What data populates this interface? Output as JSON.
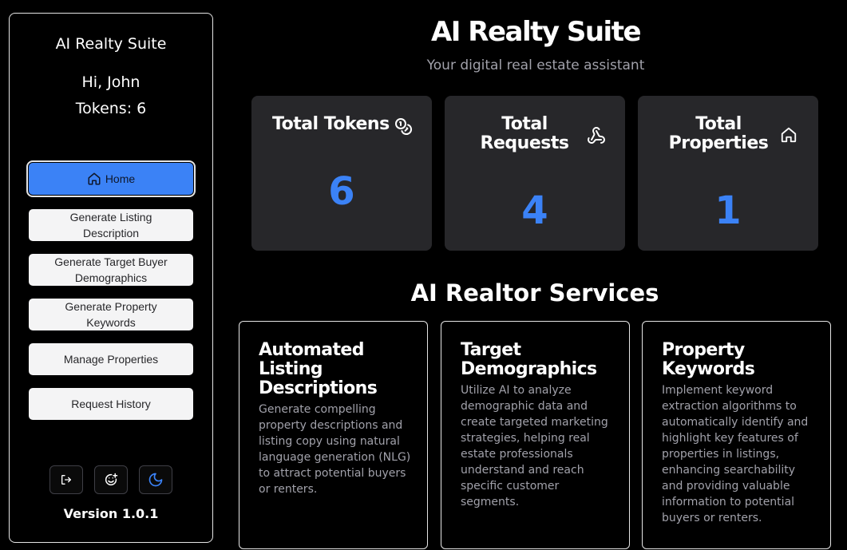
{
  "sidebar": {
    "title": "AI Realty Suite",
    "greeting": "Hi, John",
    "tokens": "Tokens: 6",
    "nav": [
      {
        "label": "Home"
      },
      {
        "label": "Generate Listing Description"
      },
      {
        "label": "Generate Target Buyer Demographics"
      },
      {
        "label": "Generate Property Keywords"
      },
      {
        "label": "Manage Properties"
      },
      {
        "label": "Request History"
      }
    ],
    "icons": [
      "logout-icon",
      "face-plus-icon",
      "moon-icon"
    ],
    "version": "Version 1.0.1"
  },
  "main": {
    "title": "AI Realty Suite",
    "subtitle": "Your digital real estate assistant",
    "stats": [
      {
        "label": "Total Tokens",
        "value": "6",
        "icon": "coins-icon"
      },
      {
        "label": "Total Requests",
        "value": "4",
        "icon": "webhook-icon"
      },
      {
        "label": "Total Properties",
        "value": "1",
        "icon": "home-icon"
      }
    ],
    "services_title": "AI Realtor Services",
    "services": [
      {
        "title": "Automated Listing Descriptions",
        "desc": "Generate compelling property descriptions and listing copy using natural language generation (NLG) to attract potential buyers or renters."
      },
      {
        "title": "Target Demographics",
        "desc": "Utilize AI to analyze demographic data and create targeted marketing strategies, helping real estate professionals understand and reach specific customer segments."
      },
      {
        "title": "Property Keywords",
        "desc": "Implement keyword extraction algorithms to automatically identify and highlight key features of properties in listings, enhancing searchability and providing valuable information to potential buyers or renters."
      }
    ]
  },
  "colors": {
    "accent": "#3b82f6",
    "card_bg": "#27272a",
    "muted_text": "#a1a1aa"
  }
}
